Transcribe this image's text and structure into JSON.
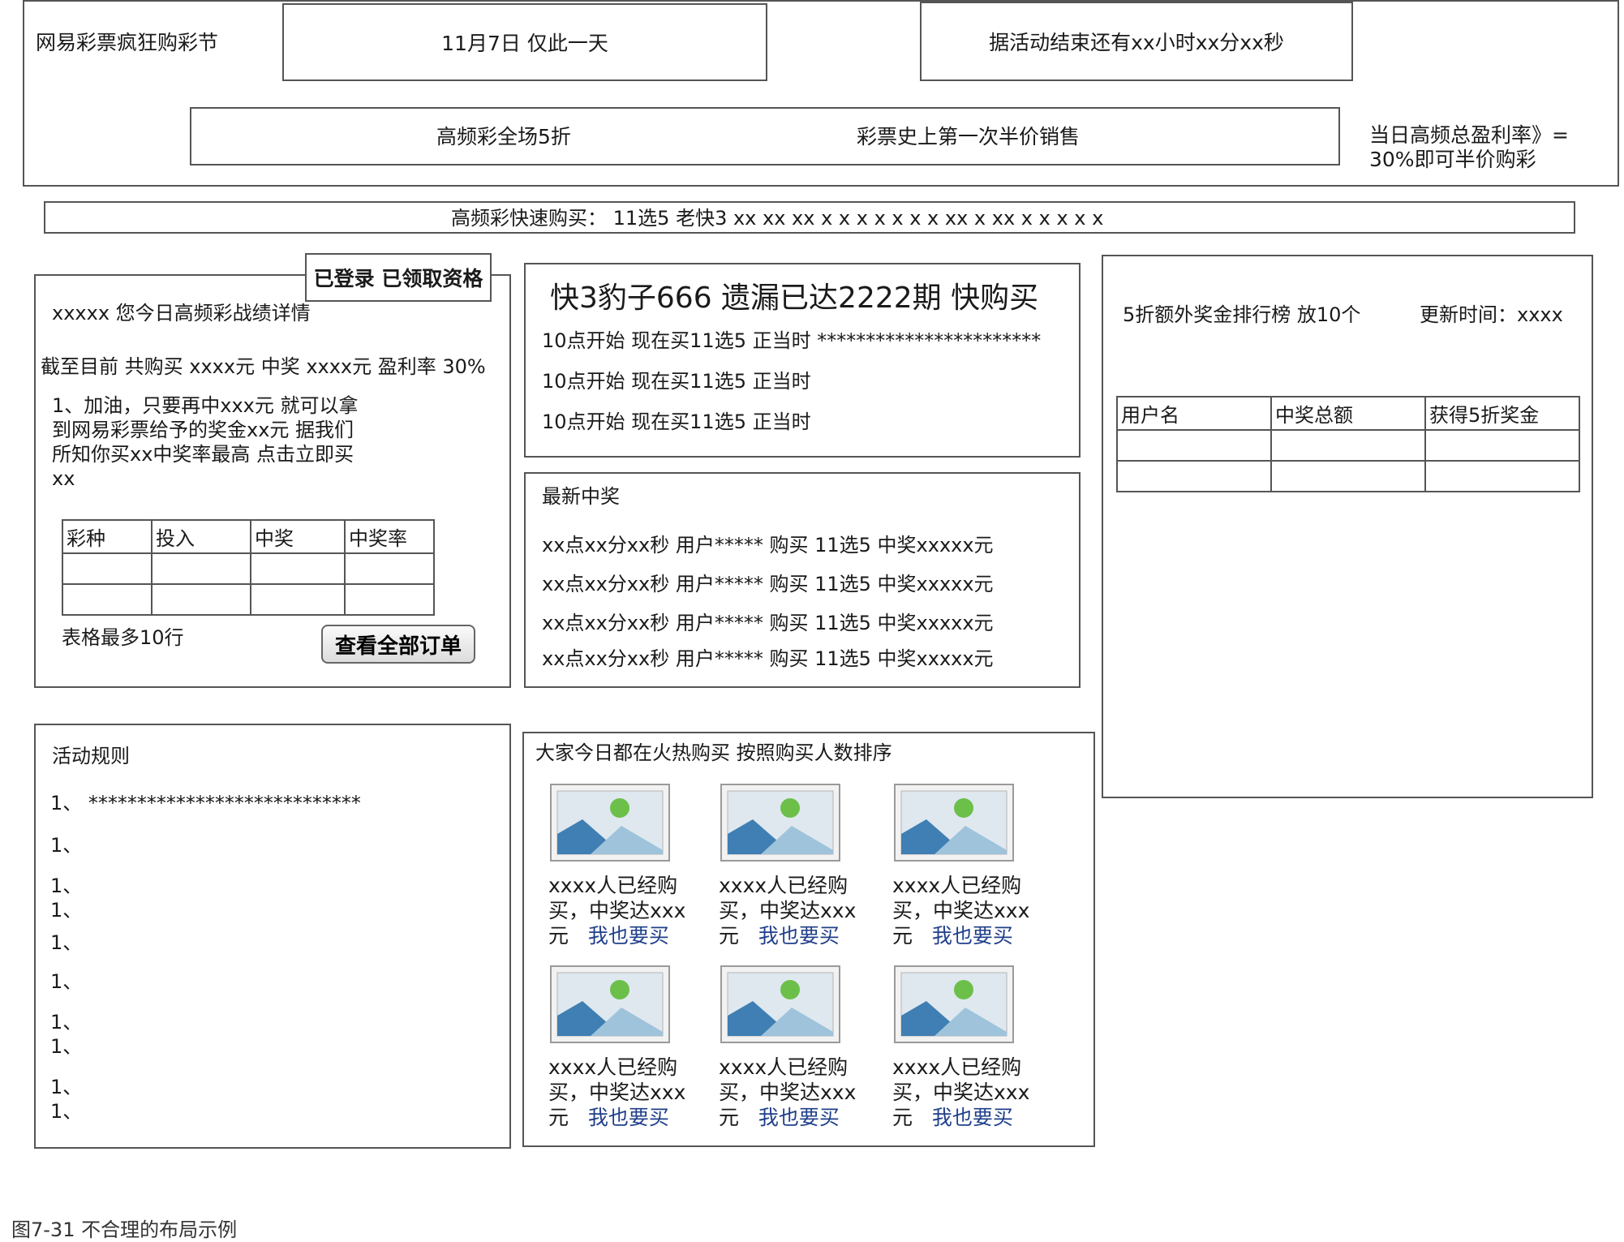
{
  "header": {
    "site_title": "网易彩票疯狂购彩节",
    "date_text": "11月7日  仅此一天",
    "countdown_text": "据活动结束还有xx小时xx分xx秒",
    "promo_left": "高频彩全场5折",
    "promo_right": "彩票史上第一次半价销售",
    "side_note_line1": "当日高频总盈利率》=",
    "side_note_line2": "30%即可半价购彩"
  },
  "quickbuy": {
    "text": "高频彩快速购买：   11选5 老快3 xx xx  xx  x  x   x  x  x x x xx x  xx  x x x x  x"
  },
  "user_panel": {
    "status_badge": "已登录 已领取资格",
    "heading": "xxxxx 您今日高频彩战绩详情",
    "summary": "截至目前 共购买 xxxx元  中奖 xxxx元   盈利率 30%",
    "tip_lines": [
      "1、加油，只要再中xxx元 就可以拿",
      "到网易彩票给予的奖金xx元  据我们",
      "所知你买xx中奖率最高  点击立即买",
      "xx"
    ],
    "table_headers": [
      "彩种",
      "投入",
      "中奖",
      "中奖率"
    ],
    "table_rows": [
      [
        "",
        "",
        "",
        ""
      ],
      [
        "",
        "",
        "",
        ""
      ]
    ],
    "table_note": "表格最多10行",
    "view_all_button": "查看全部订单"
  },
  "highlight": {
    "title": "快3豹子666 遗漏已达2222期 快购买",
    "lines": [
      "10点开始 现在买11选5 正当时 ***********************",
      "10点开始 现在买11选5 正当时",
      "10点开始 现在买11选5 正当时"
    ]
  },
  "latest": {
    "title": "最新中奖",
    "items": [
      "xx点xx分xx秒 用户***** 购买 11选5  中奖xxxxx元",
      "xx点xx分xx秒 用户***** 购买 11选5  中奖xxxxx元",
      "xx点xx分xx秒 用户***** 购买 11选5  中奖xxxxx元",
      "xx点xx分xx秒 用户***** 购买 11选5  中奖xxxxx元"
    ]
  },
  "ranking": {
    "title": "5折额外奖金排行榜 放10个",
    "update_time": "更新时间：xxxx",
    "table_headers": [
      "用户名",
      "中奖总额",
      "获得5折奖金"
    ],
    "table_rows": [
      [
        "",
        "",
        ""
      ],
      [
        "",
        "",
        ""
      ]
    ]
  },
  "rules": {
    "title": "活动规则",
    "items": [
      "1、 ****************************",
      "1、",
      "1、",
      "1、",
      "1、",
      "1、",
      "1、",
      "1、",
      "1、",
      "1、"
    ]
  },
  "popular": {
    "title": "大家今日都在火热购买   按照购买人数排序",
    "cards": [
      {
        "line1": "xxxx人已经购",
        "line2": "买，中奖达xxx",
        "line3": "元",
        "link": "我也要买"
      },
      {
        "line1": "xxxx人已经购",
        "line2": "买，中奖达xxx",
        "line3": "元",
        "link": "我也要买"
      },
      {
        "line1": "xxxx人已经购",
        "line2": "买，中奖达xxx",
        "line3": "元",
        "link": "我也要买"
      },
      {
        "line1": "xxxx人已经购",
        "line2": "买，中奖达xxx",
        "line3": "元",
        "link": "我也要买"
      },
      {
        "line1": "xxxx人已经购",
        "line2": "买，中奖达xxx",
        "line3": "元",
        "link": "我也要买"
      },
      {
        "line1": "xxxx人已经购",
        "line2": "买，中奖达xxx",
        "line3": "元",
        "link": "我也要买"
      }
    ],
    "image_icon": "image-placeholder-icon"
  },
  "caption": "图7-31 不合理的布局示例",
  "colors": {
    "border": "#555555",
    "link": "#1f3f8a",
    "image_sky": "#dfe8ef",
    "image_mountain_dark": "#3f7fb3",
    "image_mountain_light": "#9ec3db",
    "image_sun": "#6cc04a"
  }
}
